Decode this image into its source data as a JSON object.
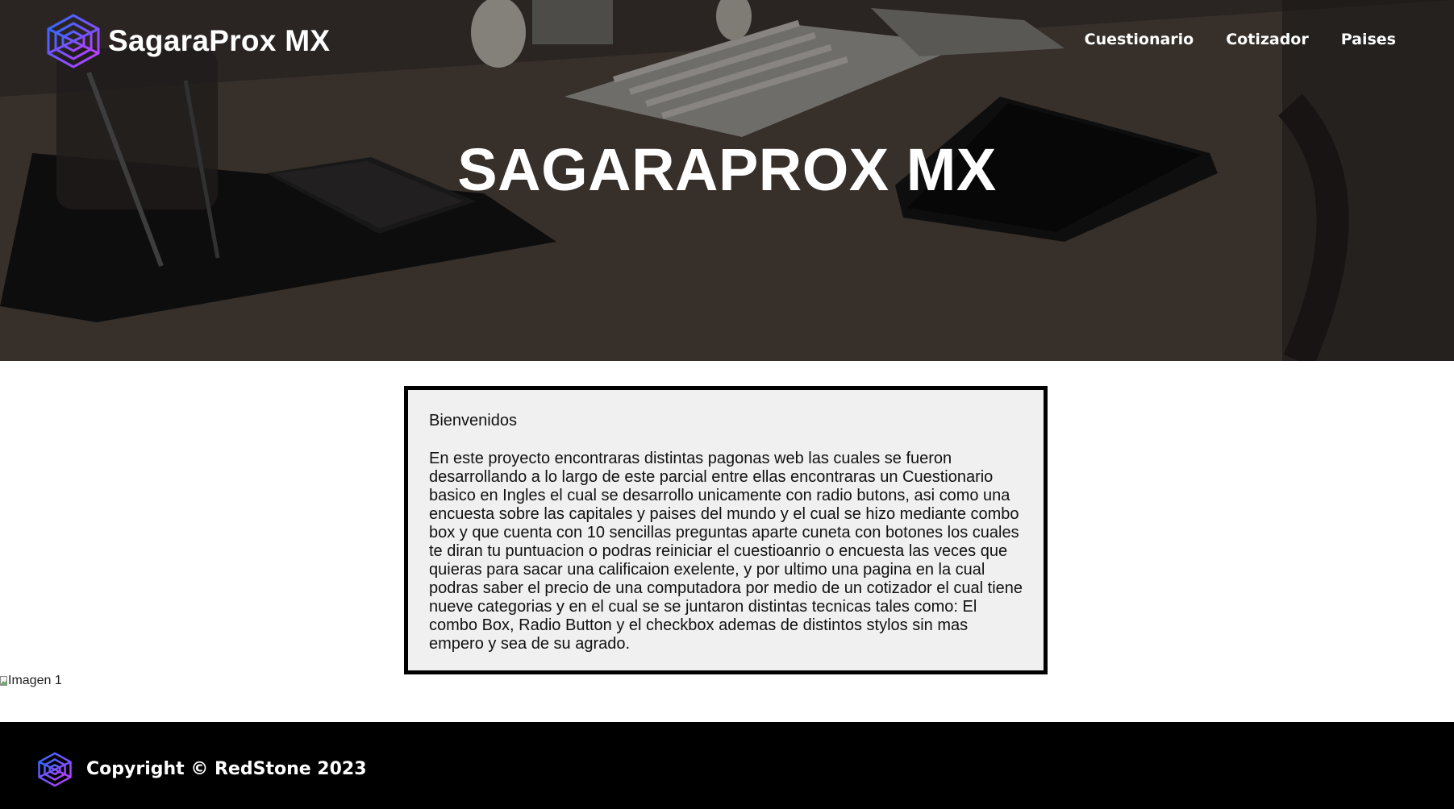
{
  "header": {
    "brand_name": "SagaraProx MX",
    "logo_icon": "spiderweb-logo-icon",
    "nav": [
      {
        "label": "Cuestionario"
      },
      {
        "label": "Cotizador"
      },
      {
        "label": "Paises"
      }
    ]
  },
  "hero": {
    "title": "SAGARAPROX MX"
  },
  "welcome": {
    "heading": "Bienvenidos",
    "body": "En este proyecto encontraras distintas pagonas web las cuales se fueron desarrollando a lo largo de este parcial entre ellas encontraras un Cuestionario basico en Ingles el cual se desarrollo unicamente con radio butons, asi como una encuesta sobre las capitales y paises del mundo y el cual se hizo mediante combo box y que cuenta con 10 sencillas preguntas aparte cuneta con botones los cuales te diran tu puntuacion o podras reiniciar el cuestioanrio o encuesta las veces que quieras para sacar una calificaion exelente, y por ultimo una pagina en la cual podras saber el precio de una computadora por medio de un cotizador el cual tiene nueve categorias y en el cual se se juntaron distintas tecnicas tales como: El combo Box, Radio Button y el checkbox ademas de distintos stylos sin mas empero y sea de su agrado."
  },
  "image": {
    "alt": "Imagen 1",
    "icon": "broken-image-icon"
  },
  "footer": {
    "copyright": "Copyright © RedStone 2023",
    "logo_icon": "spiderweb-logo-icon"
  },
  "colors": {
    "logo_gradient_start": "#2d6bff",
    "logo_gradient_end": "#c23bff",
    "box_background": "#f0f0f0",
    "footer_background": "#000000"
  }
}
